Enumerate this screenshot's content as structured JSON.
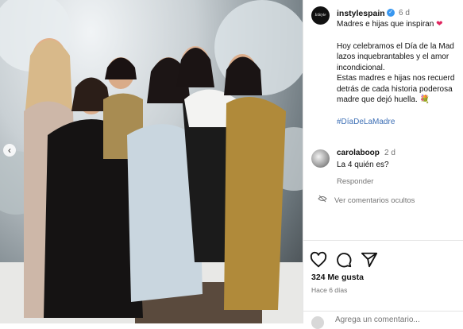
{
  "photo": {
    "description_icon": "image-carousel",
    "prev_icon": "chevron-left-icon"
  },
  "post": {
    "username": "instylespain",
    "avatar_text": "InStyle",
    "time": "6 d",
    "caption_title": "Madres e hijas que inspiran",
    "caption_lines": [
      "Hoy celebramos el Día de la Mad",
      "lazos inquebrantables y el amor",
      "incondicional.",
      "Estas madres e hijas nos recuerd",
      "detrás de cada historia poderosa",
      "madre que dejó huella."
    ],
    "hashtag": "#DíaDeLaMadre"
  },
  "comment": {
    "username": "carolaboop",
    "time": "2 d",
    "text": "La 4 quién es?",
    "reply_label": "Responder"
  },
  "hidden_comments_label": "Ver comentarios ocultos",
  "likes_label": "324 Me gusta",
  "posted_ago": "Hace 6 días",
  "add_comment_placeholder": "Agrega un comentario...",
  "colors": {
    "accent": "#3897f0",
    "hashtag": "#3d6fb5",
    "heart": "#e0245e"
  }
}
